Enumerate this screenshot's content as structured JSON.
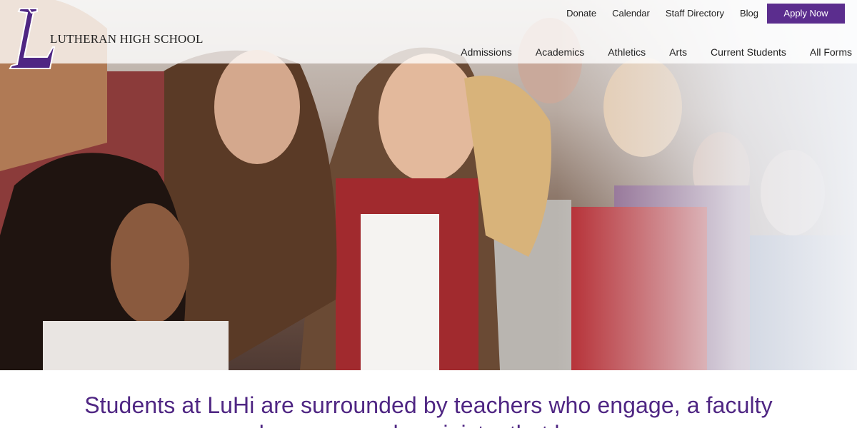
{
  "header": {
    "school_name": "LUTHERAN HIGH SCHOOL",
    "logo_icon": "lutheran-l-logo-icon",
    "brand_color": "#5b2d8e"
  },
  "utility_nav": {
    "items": [
      "Donate",
      "Calendar",
      "Staff Directory",
      "Blog"
    ],
    "apply_label": "Apply Now"
  },
  "main_nav": {
    "items": [
      "Admissions",
      "Academics",
      "Athletics",
      "Arts",
      "Current Students",
      "All Forms"
    ]
  },
  "hero": {
    "image": "students-cheering-photo"
  },
  "content": {
    "tagline_line1": "Students at LuHi are surrounded by teachers who engage, a faculty",
    "tagline_line2": "who cares, and a ministry that loves."
  }
}
